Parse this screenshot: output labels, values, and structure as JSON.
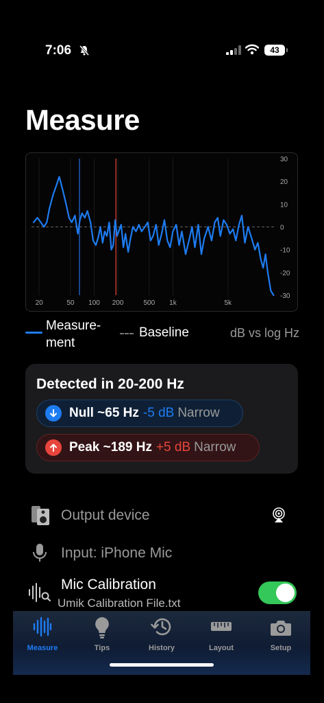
{
  "status": {
    "time": "7:06",
    "battery": "43"
  },
  "page": {
    "title": "Measure"
  },
  "chart_data": {
    "type": "line",
    "x_scale": "log",
    "x_ticks": [
      "20",
      "50",
      "100",
      "200",
      "500",
      "1k",
      "5k"
    ],
    "x_tick_values": [
      20,
      50,
      100,
      200,
      500,
      1000,
      5000
    ],
    "y_ticks": [
      "30",
      "20",
      "10",
      "0",
      "-10",
      "-20",
      "-30"
    ],
    "y_tick_values": [
      30,
      20,
      10,
      0,
      -10,
      -20,
      -30
    ],
    "ylim": [
      -30,
      30
    ],
    "xlim": [
      16,
      20000
    ],
    "markers": [
      {
        "x": 65,
        "color": "#1e5bb8"
      },
      {
        "x": 189,
        "color": "#c0392b"
      }
    ],
    "series": [
      {
        "name": "Measure-ment",
        "color": "#1e7cf2",
        "x": [
          17,
          19,
          21,
          23,
          25,
          27,
          30,
          33,
          36,
          40,
          44,
          48,
          52,
          57,
          62,
          66,
          70,
          76,
          82,
          90,
          97,
          105,
          112,
          120,
          128,
          136,
          145,
          155,
          165,
          175,
          185,
          195,
          205,
          220,
          235,
          250,
          270,
          290,
          310,
          340,
          370,
          400,
          440,
          480,
          520,
          560,
          610,
          660,
          720,
          780,
          850,
          920,
          1000,
          1100,
          1200,
          1300,
          1450,
          1600,
          1750,
          1900,
          2100,
          2300,
          2500,
          2800,
          3100,
          3400,
          3700,
          4000,
          4400,
          4800,
          5300,
          5800,
          6300,
          6900,
          7500,
          8200,
          9000,
          10000,
          11000,
          12000,
          13000,
          14000,
          15000,
          16000,
          17500,
          19000
        ],
        "y": [
          2,
          4,
          2,
          0,
          2,
          8,
          14,
          18,
          22,
          16,
          10,
          4,
          2,
          5,
          -3,
          3,
          6,
          4,
          7,
          2,
          -6,
          -8,
          -5,
          0,
          -7,
          -2,
          -4,
          2,
          -10,
          -8,
          3,
          -4,
          -2,
          1,
          -9,
          -3,
          -11,
          -5,
          0,
          -2,
          1,
          -2,
          0,
          2,
          -6,
          -4,
          1,
          -8,
          -3,
          3,
          -6,
          -9,
          -2,
          1,
          -8,
          -2,
          -12,
          -6,
          0,
          -9,
          1,
          -12,
          -5,
          0,
          -6,
          2,
          4,
          -4,
          3,
          1,
          -3,
          -1,
          -6,
          1,
          5,
          -7,
          0,
          -5,
          -10,
          -7,
          -14,
          -18,
          -12,
          -20,
          -28,
          -30
        ]
      }
    ],
    "legend": {
      "measurement": "Measure-\nment",
      "baseline": "Baseline",
      "scale": "dB vs log Hz"
    }
  },
  "legend": {
    "measurement": "Measure-ment",
    "baseline": "Baseline",
    "scale": "dB vs log Hz"
  },
  "detected": {
    "title": "Detected in 20-200 Hz",
    "null": {
      "label": "Null ~65 Hz",
      "db": "-5 dB",
      "width": "Narrow",
      "icon": "arrow-down-icon",
      "color": "#1e7cf2"
    },
    "peak": {
      "label": "Peak ~189 Hz",
      "db": "+5 dB",
      "width": "Narrow",
      "icon": "arrow-up-icon",
      "color": "#e8453c"
    }
  },
  "settings": {
    "output": {
      "label": "Output device",
      "icon": "speaker-icon"
    },
    "input": {
      "label": "Input: iPhone Mic",
      "icon": "microphone-icon"
    },
    "mic_calibration": {
      "label": "Mic Calibration",
      "file": "Umik Calibration File.txt",
      "enabled": true
    }
  },
  "tabs": [
    {
      "label": "Measure",
      "icon": "waveform-icon",
      "active": true
    },
    {
      "label": "Tips",
      "icon": "lightbulb-icon",
      "active": false
    },
    {
      "label": "History",
      "icon": "history-icon",
      "active": false
    },
    {
      "label": "Layout",
      "icon": "ruler-icon",
      "active": false
    },
    {
      "label": "Setup",
      "icon": "camera-icon",
      "active": false
    }
  ],
  "colors": {
    "accent": "#1e7cf2",
    "peak": "#e8453c",
    "toggle_on": "#34c759"
  }
}
